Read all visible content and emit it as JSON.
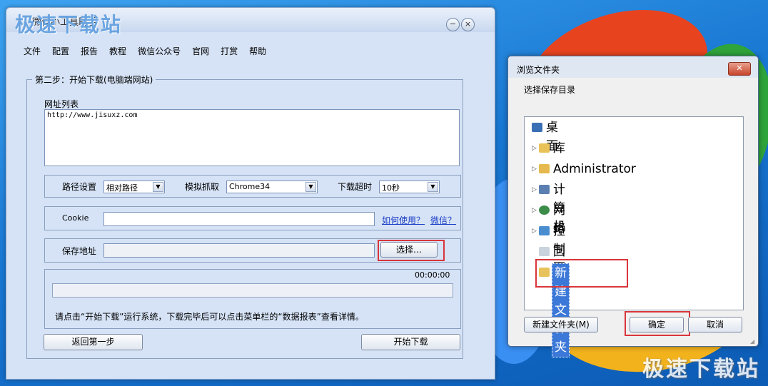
{
  "main_window": {
    "watermark": "极速下载站",
    "title": "微信小工具助手",
    "minimize_glyph": "−",
    "close_glyph": "×",
    "menu": [
      "文件",
      "配置",
      "报告",
      "教程",
      "微信公众号",
      "官网",
      "打赏",
      "帮助"
    ],
    "group_title": "第二步：开始下载(电脑端网站)",
    "url_list_label": "网址列表",
    "url_list_value": "http://www.jisuxz.com",
    "path_label": "路径设置",
    "path_value": "相对路径",
    "simulate_label": "模拟抓取",
    "simulate_value": "Chrome34",
    "timeout_label": "下载超时",
    "timeout_value": "10秒",
    "cookie_label": "Cookie",
    "cookie_value": "",
    "how_to_link": "如何使用？",
    "wechat_link": "微信？",
    "save_label": "保存地址",
    "save_value": "",
    "select_button": "选择…",
    "time_display": "00:00:00",
    "progress": 0,
    "status_text": "请点击“开始下载”运行系统，下载完毕后可以点击菜单栏的“数据报表”查看详情。",
    "back_button": "返回第一步",
    "start_button": "开始下载"
  },
  "browse_dialog": {
    "title": "浏览文件夹",
    "close_glyph": "✕",
    "subtitle": "选择保存目录",
    "tree": [
      {
        "label": "桌面",
        "icon": "desktop-icon",
        "expandable": false
      },
      {
        "label": "库",
        "icon": "library-icon",
        "expandable": true
      },
      {
        "label": "Administrator",
        "icon": "user-folder-icon",
        "expandable": true
      },
      {
        "label": "计算机",
        "icon": "computer-icon",
        "expandable": true
      },
      {
        "label": "网络",
        "icon": "network-icon",
        "expandable": true
      },
      {
        "label": "控制面板",
        "icon": "control-panel-icon",
        "expandable": true
      },
      {
        "label": "回收站",
        "icon": "recycle-bin-icon",
        "expandable": false
      },
      {
        "label": "新建文件夹",
        "icon": "folder-icon",
        "expandable": false,
        "editing": true
      }
    ],
    "new_folder_button": "新建文件夹(M)",
    "ok_button": "确定",
    "cancel_button": "取消"
  },
  "desktop_watermark": "极速下载站",
  "colors": {
    "highlight_red": "#d9353b",
    "selection_blue": "#3b78d8",
    "link_blue": "#1d3fc5"
  }
}
